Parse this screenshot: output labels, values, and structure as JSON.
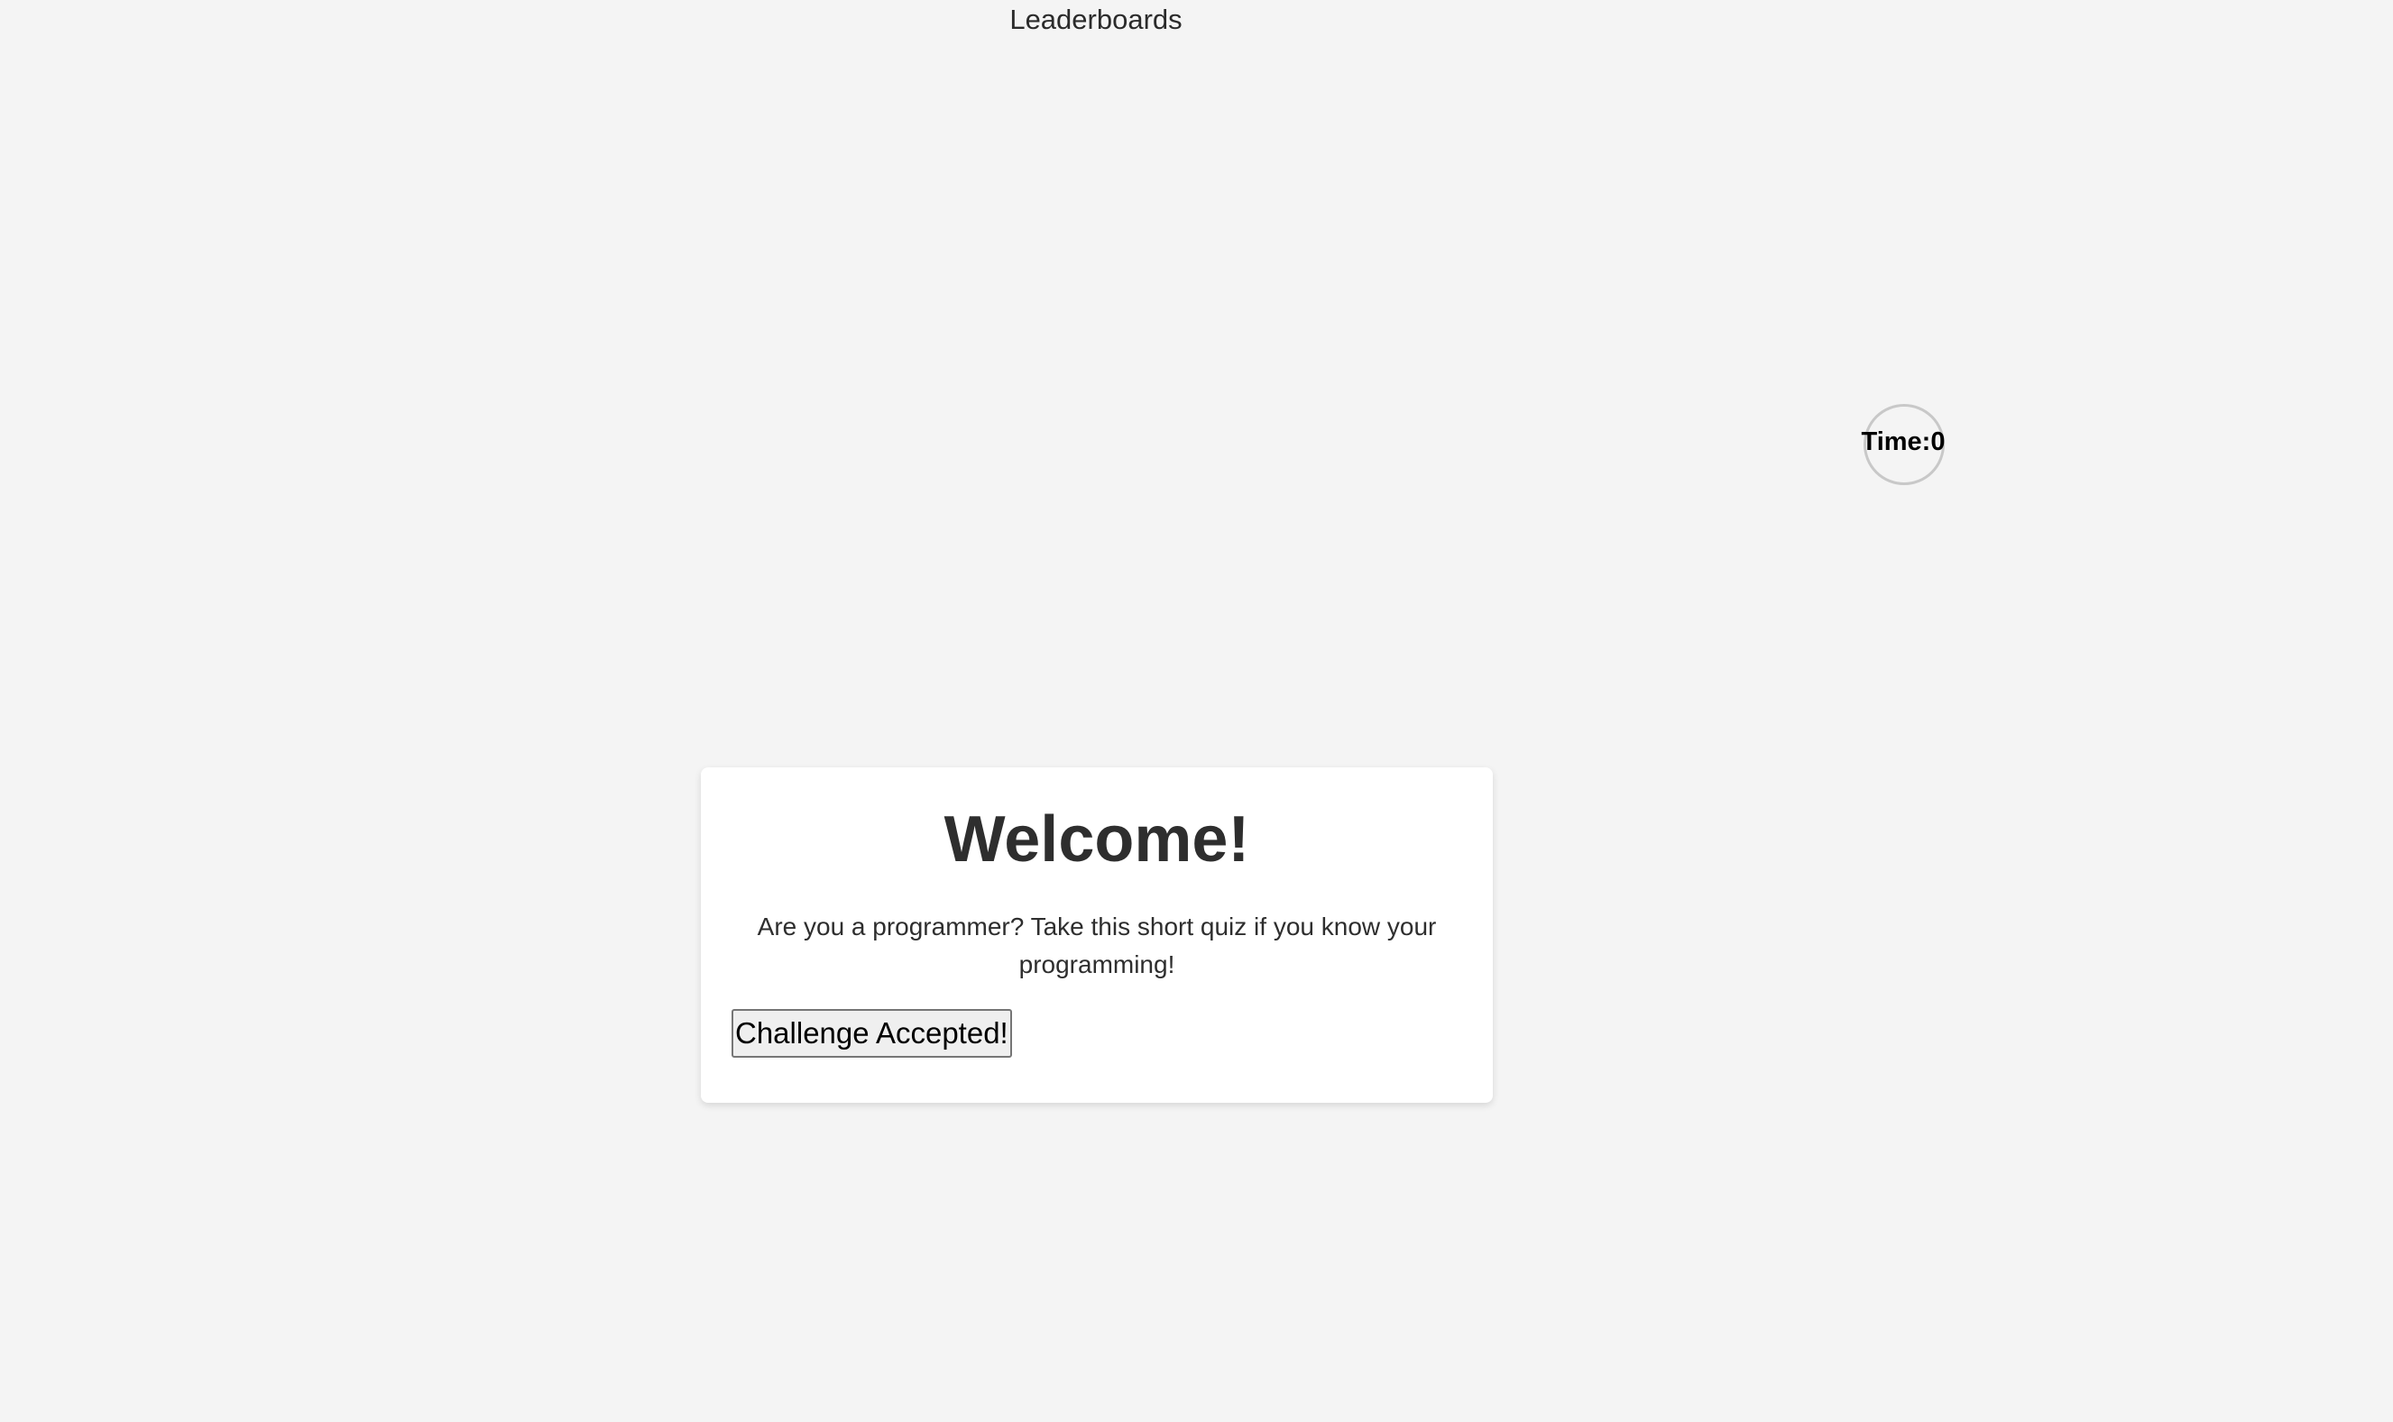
{
  "nav": {
    "leaderboards_label": "Leaderboards"
  },
  "timer": {
    "label": "Time:",
    "value": "0",
    "text": "Time:0"
  },
  "welcome": {
    "title": "Welcome!",
    "description": "Are you a programmer? Take this short quiz if you know your programming!",
    "start_button": "Challenge Accepted!"
  }
}
